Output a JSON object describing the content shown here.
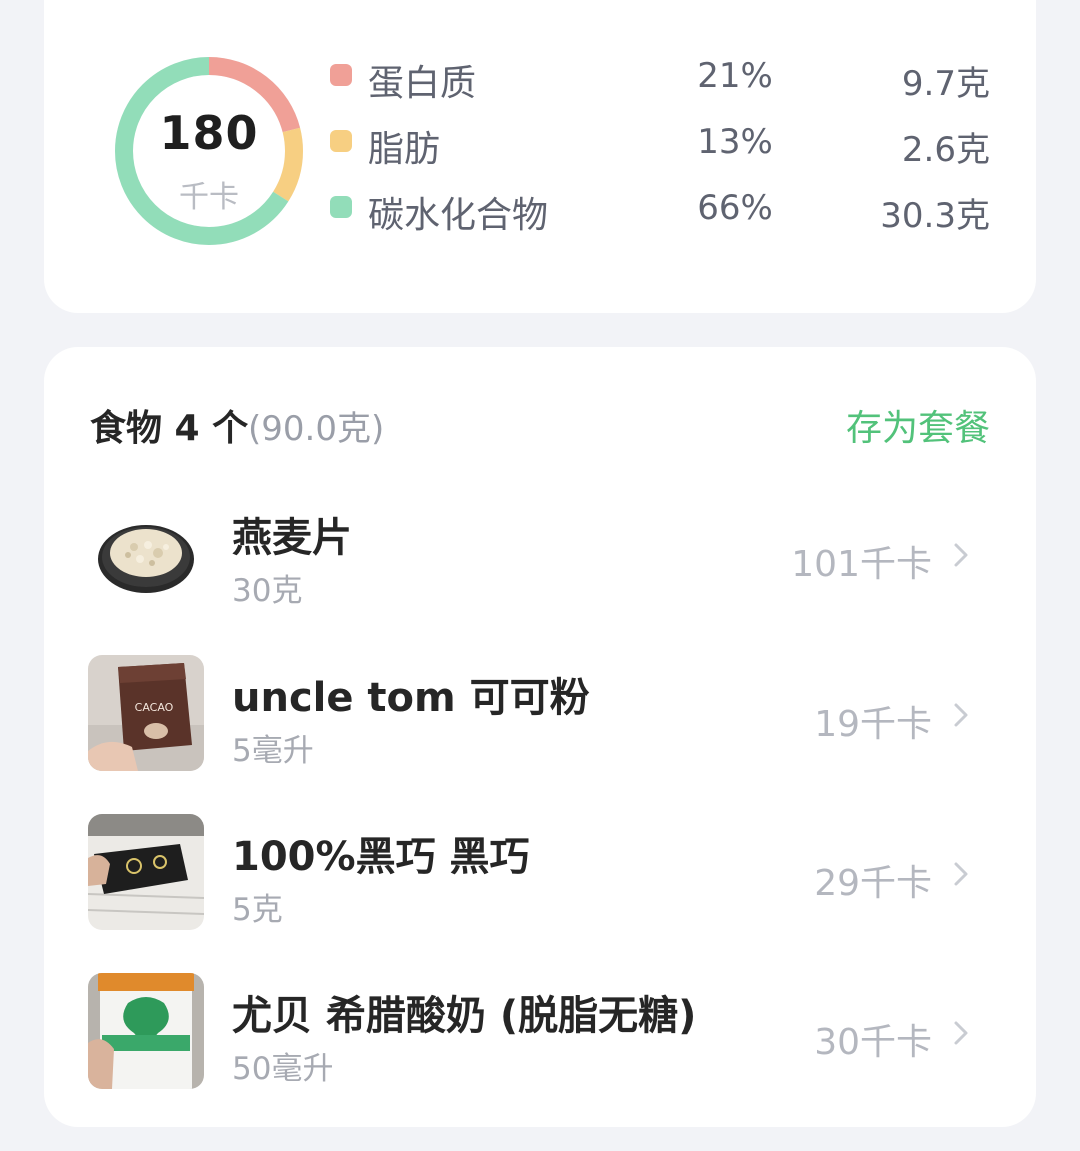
{
  "summary": {
    "kcal_value": "180",
    "kcal_unit": "千卡",
    "macros": [
      {
        "name": "蛋白质",
        "percent": "21%",
        "grams": "9.7克",
        "color": "#f0a097",
        "fraction": 0.21
      },
      {
        "name": "脂肪",
        "percent": "13%",
        "grams": "2.6克",
        "color": "#f7cf82",
        "fraction": 0.13
      },
      {
        "name": "碳水化合物",
        "percent": "66%",
        "grams": "30.3克",
        "color": "#92ddb9",
        "fraction": 0.66
      }
    ]
  },
  "foods": {
    "title": "食物 4 个",
    "total_weight": "(90.0克)",
    "save_label": "存为套餐",
    "items": [
      {
        "name": "燕麦片",
        "amount": "30克",
        "kcal": "101千卡",
        "icon": "oatmeal-thumbnail"
      },
      {
        "name": "uncle tom 可可粉",
        "amount": "5毫升",
        "kcal": "19千卡",
        "icon": "cacao-powder-thumbnail"
      },
      {
        "name": "100%黑巧 黑巧",
        "amount": "5克",
        "kcal": "29千卡",
        "icon": "dark-chocolate-thumbnail"
      },
      {
        "name": "尤贝 希腊酸奶 (脱脂无糖)",
        "amount": "50毫升",
        "kcal": "30千卡",
        "icon": "greek-yogurt-thumbnail"
      }
    ],
    "cacao_label": "CACAO"
  },
  "colors": {
    "accent_green": "#52c27a",
    "background": "#f2f3f7",
    "card": "#ffffff"
  }
}
